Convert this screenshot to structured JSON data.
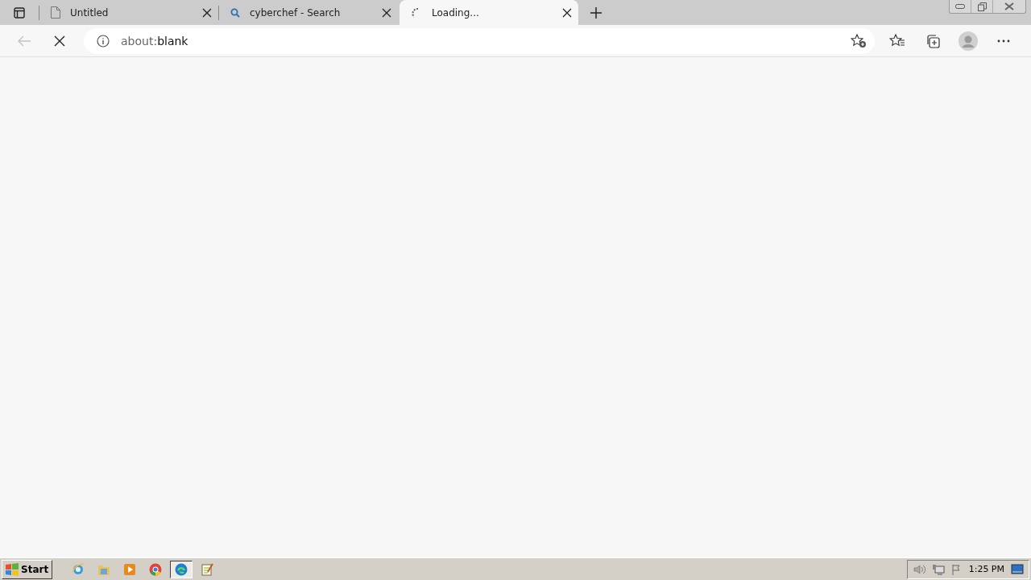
{
  "tabs": [
    {
      "title": "Untitled",
      "kind": "page",
      "selected": false
    },
    {
      "title": "cyberchef - Search",
      "kind": "search",
      "selected": false
    },
    {
      "title": "Loading...",
      "kind": "spinner",
      "selected": true
    }
  ],
  "toolbar": {
    "back_disabled": true,
    "loading": true,
    "address": {
      "scheme": "about:",
      "path": "blank"
    }
  },
  "taskbar": {
    "start": "Start",
    "apps": [
      {
        "kind": "ie",
        "selected": false
      },
      {
        "kind": "folder",
        "selected": false
      },
      {
        "kind": "media",
        "selected": false
      },
      {
        "kind": "chrome",
        "selected": false
      },
      {
        "kind": "edge",
        "selected": true
      },
      {
        "kind": "notepad",
        "selected": false
      }
    ],
    "clock": "1:25 PM"
  }
}
